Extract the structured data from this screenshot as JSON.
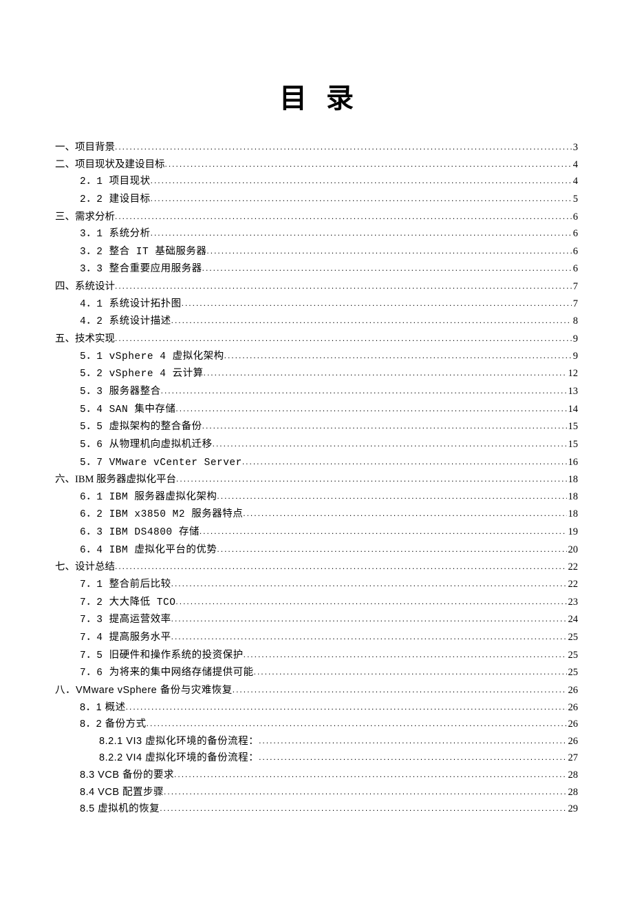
{
  "title": "目录",
  "toc": [
    {
      "level": 1,
      "label": "一、项目背景",
      "page": "3",
      "mono": false
    },
    {
      "level": 1,
      "label": "二、项目现状及建设目标",
      "page": "4",
      "mono": false
    },
    {
      "level": 2,
      "label": "2．1 项目现状",
      "page": "4",
      "mono": true
    },
    {
      "level": 2,
      "label": "2．2 建设目标",
      "page": "5",
      "mono": true
    },
    {
      "level": 1,
      "label": "三、需求分析",
      "page": "6",
      "mono": false
    },
    {
      "level": 2,
      "label": "3．1 系统分析",
      "page": "6",
      "mono": true
    },
    {
      "level": 2,
      "label": "3．2 整合 IT 基础服务器",
      "page": "6",
      "mono": true
    },
    {
      "level": 2,
      "label": "3．3 整合重要应用服务器",
      "page": "6",
      "mono": true
    },
    {
      "level": 1,
      "label": "四、系统设计",
      "page": "7",
      "mono": false
    },
    {
      "level": 2,
      "label": "4．1 系统设计拓扑图",
      "page": "7",
      "mono": true
    },
    {
      "level": 2,
      "label": "4．2 系统设计描述",
      "page": "8",
      "mono": true
    },
    {
      "level": 1,
      "label": "五、技术实现",
      "page": "9",
      "mono": false
    },
    {
      "level": 2,
      "label": "5．1 vSphere 4 虚拟化架构",
      "page": "9",
      "mono": true
    },
    {
      "level": 2,
      "label": "5．2 vSphere 4 云计算",
      "page": "12",
      "mono": true
    },
    {
      "level": 2,
      "label": "5．3 服务器整合",
      "page": "13",
      "mono": true
    },
    {
      "level": 2,
      "label": "5．4 SAN 集中存储",
      "page": "14",
      "mono": true
    },
    {
      "level": 2,
      "label": "5．5 虚拟架构的整合备份",
      "page": "15",
      "mono": true
    },
    {
      "level": 2,
      "label": "5．6 从物理机向虚拟机迁移",
      "page": "15",
      "mono": true
    },
    {
      "level": 2,
      "label": "5．7 VMware vCenter Server",
      "page": "16",
      "mono": true
    },
    {
      "level": 1,
      "label": "六、IBM 服务器虚拟化平台",
      "page": "18",
      "mono": false
    },
    {
      "level": 2,
      "label": "6．1 IBM 服务器虚拟化架构",
      "page": "18",
      "mono": true
    },
    {
      "level": 2,
      "label": "6．2 IBM x3850 M2 服务器特点",
      "page": "18",
      "mono": true
    },
    {
      "level": 2,
      "label": "6．3 IBM DS4800 存储",
      "page": "19",
      "mono": true
    },
    {
      "level": 2,
      "label": "6．4 IBM 虚拟化平台的优势",
      "page": "20",
      "mono": true
    },
    {
      "level": 1,
      "label": "七、设计总结",
      "page": "22",
      "mono": false
    },
    {
      "level": 2,
      "label": "7．1 整合前后比较",
      "page": "22",
      "mono": true
    },
    {
      "level": 2,
      "label": "7．2 大大降低 TCO",
      "page": "23",
      "mono": true
    },
    {
      "level": 2,
      "label": "7．3 提高运营效率",
      "page": "24",
      "mono": true
    },
    {
      "level": 2,
      "label": "7．4 提高服务水平",
      "page": "25",
      "mono": true
    },
    {
      "level": 2,
      "label": "7．5 旧硬件和操作系统的投资保护",
      "page": "25",
      "mono": true
    },
    {
      "level": 2,
      "label": "7．6 为将来的集中网络存储提供可能",
      "page": "25",
      "mono": true
    },
    {
      "level": 1,
      "label": "八．VMware vSphere 备份与灾难恢复",
      "page": "26",
      "mono": true,
      "sans": true
    },
    {
      "level": 2,
      "label": "8．1 概述 ",
      "page": "26",
      "mono": true,
      "sans": true
    },
    {
      "level": 2,
      "label": "8．2 备份方式 ",
      "page": "26",
      "mono": true,
      "sans": true
    },
    {
      "level": 3,
      "label": "8.2.1 VI3 虚拟化环境的备份流程： ",
      "page": "26",
      "mono": true,
      "sans": true
    },
    {
      "level": 3,
      "label": "8.2.2 VI4 虚拟化环境的备份流程： ",
      "page": "27",
      "mono": true,
      "sans": true
    },
    {
      "level": 2,
      "label": "8.3 VCB 备份的要求 ",
      "page": "28",
      "mono": true,
      "sans": true
    },
    {
      "level": 2,
      "label": "8.4 VCB 配置步骤 ",
      "page": "28",
      "mono": true,
      "sans": true
    },
    {
      "level": 2,
      "label": "8.5  虚拟机的恢复 ",
      "page": "29",
      "mono": true,
      "sans": true
    }
  ]
}
